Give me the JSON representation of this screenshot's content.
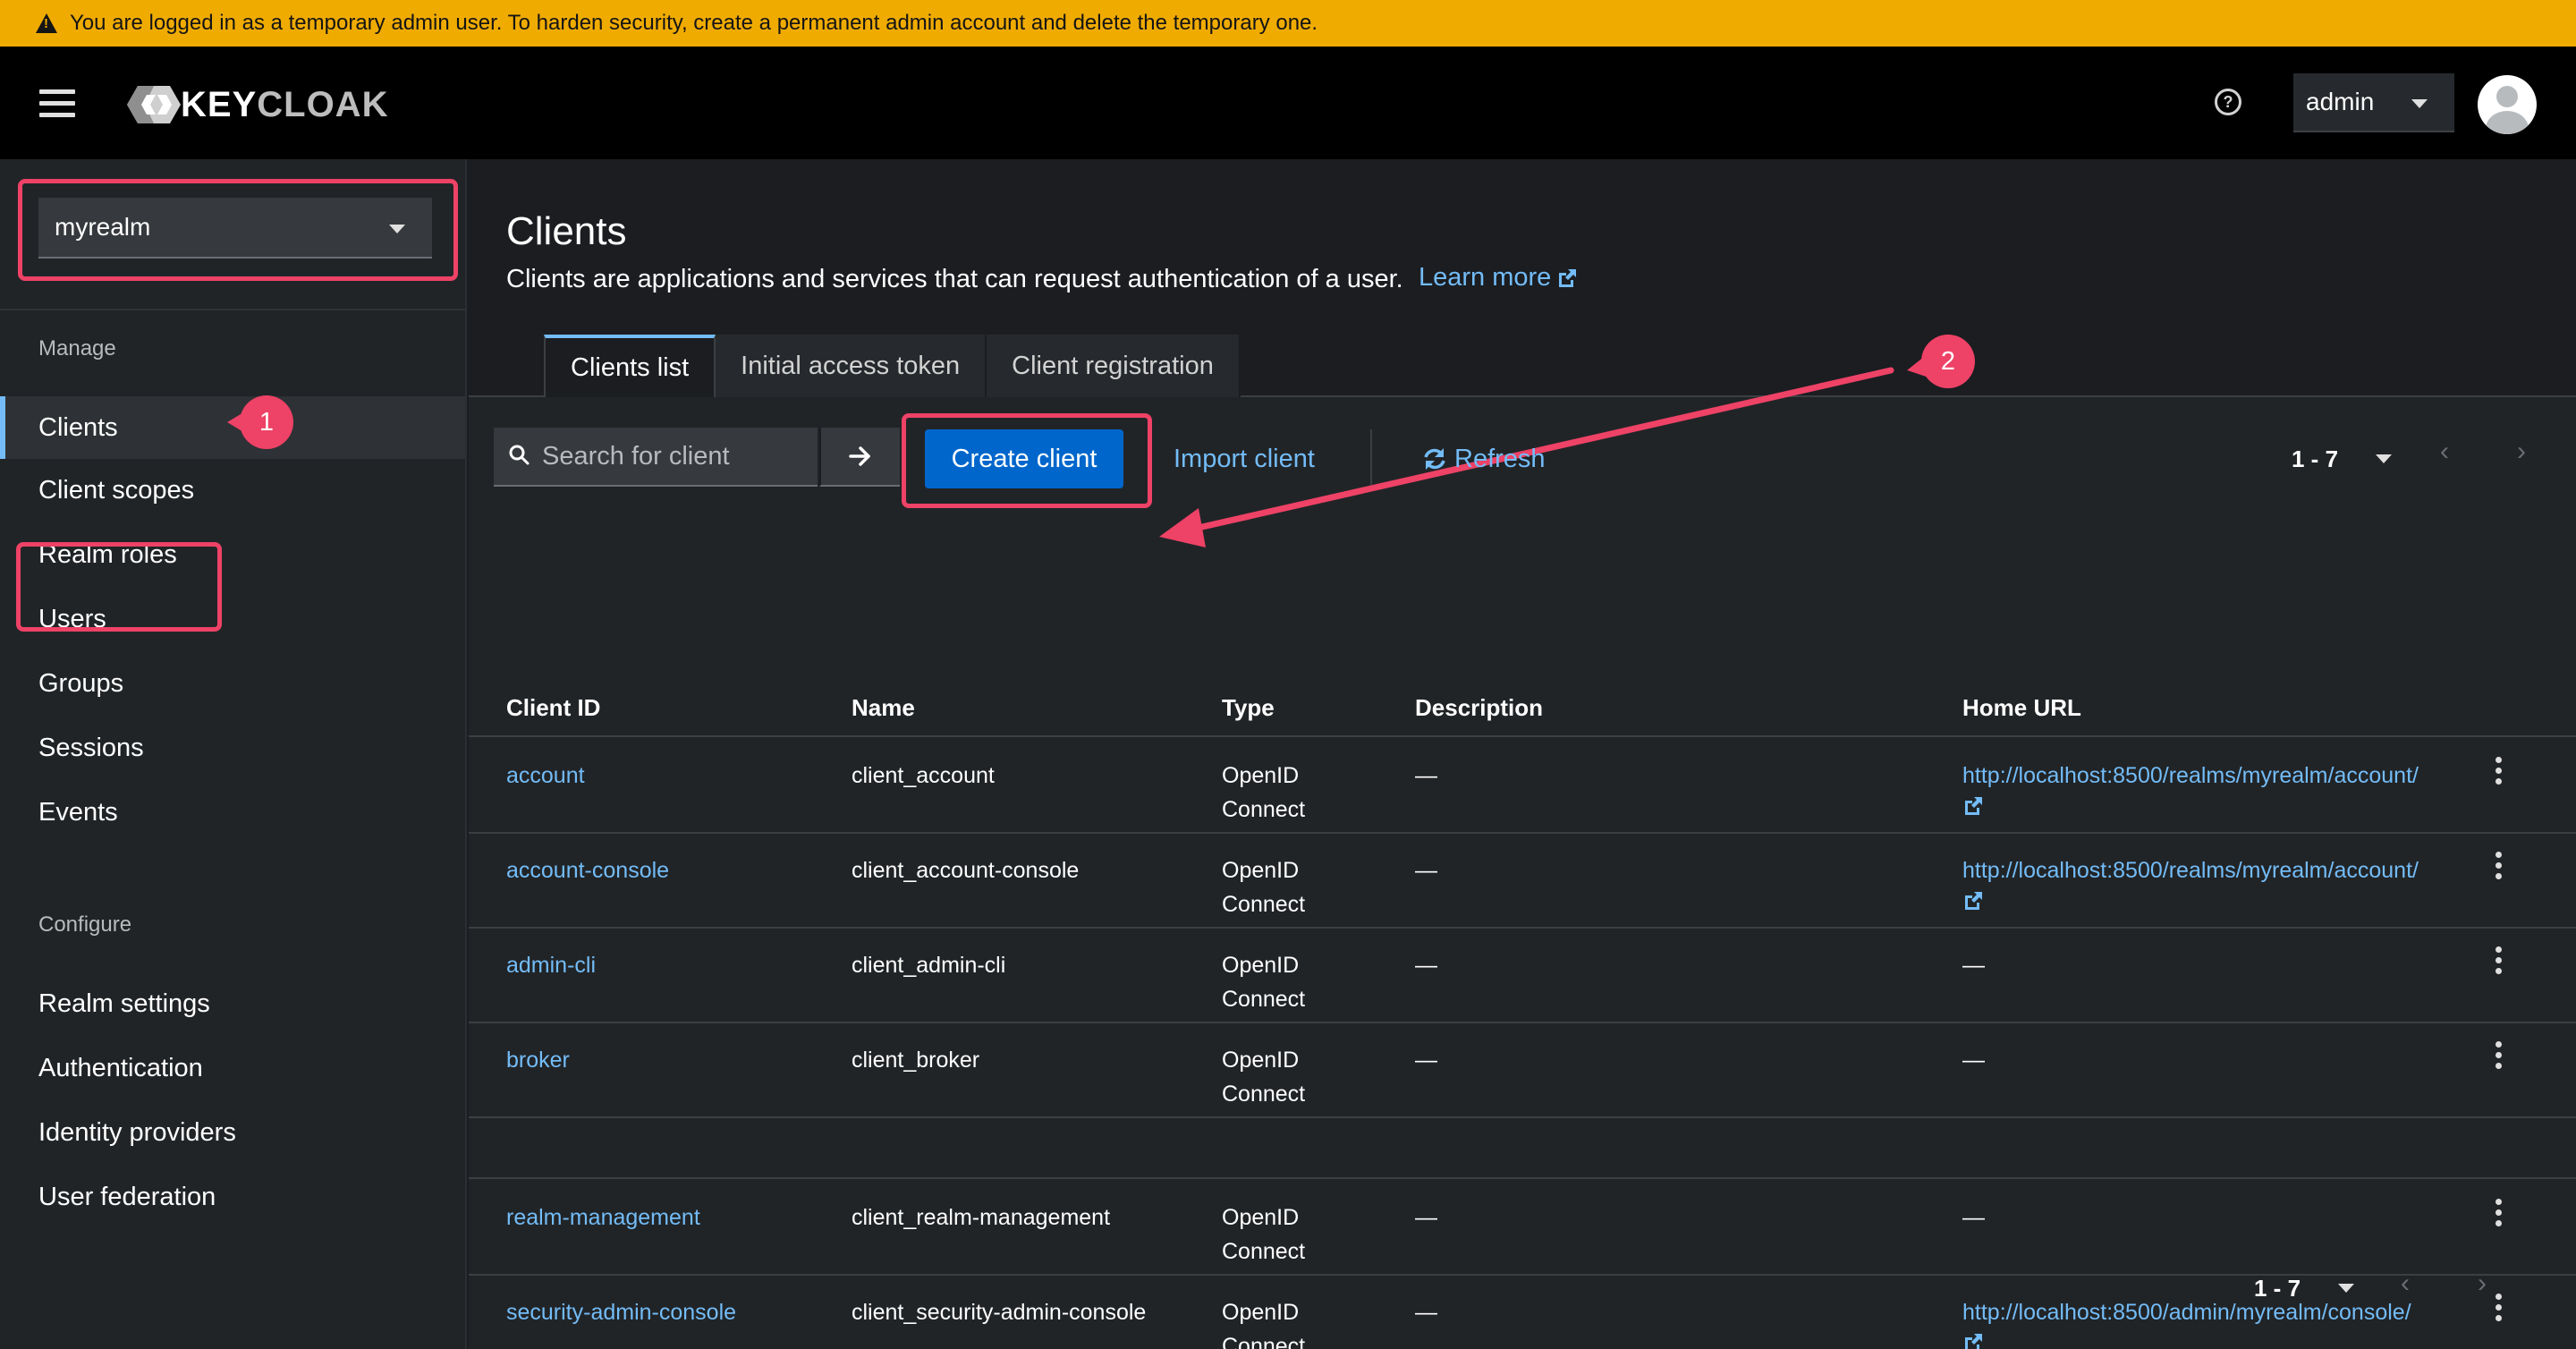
{
  "banner": {
    "text": "You are logged in as a temporary admin user. To harden security, create a permanent admin account and delete the temporary one."
  },
  "masthead": {
    "logo_key": "KEY",
    "logo_cloak": "CLOAK",
    "user": "admin",
    "help_glyph": "?"
  },
  "sidebar": {
    "realm": "myrealm",
    "manage_label": "Manage",
    "manage_items": [
      "Clients",
      "Client scopes",
      "Realm roles",
      "Users",
      "Groups",
      "Sessions",
      "Events"
    ],
    "configure_label": "Configure",
    "configure_items": [
      "Realm settings",
      "Authentication",
      "Identity providers",
      "User federation"
    ]
  },
  "annotations": {
    "badge1": "1",
    "badge2": "2"
  },
  "page": {
    "title": "Clients",
    "description": "Clients are applications and services that can request authentication of a user.",
    "learn_more": "Learn more",
    "tabs": [
      "Clients list",
      "Initial access token",
      "Client registration"
    ]
  },
  "toolbar": {
    "search_placeholder": "Search for client",
    "create_label": "Create client",
    "import_label": "Import client",
    "refresh_label": "Refresh",
    "pagination": "1 - 7"
  },
  "table": {
    "headers": [
      "Client ID",
      "Name",
      "Type",
      "Description",
      "Home URL"
    ],
    "rows": [
      {
        "id": "account",
        "name": "client_account",
        "type1": "OpenID",
        "type2": "Connect",
        "description": "—",
        "url": "http://localhost:8500/realms/myrealm/account/"
      },
      {
        "id": "account-console",
        "name": "client_account-console",
        "type1": "OpenID",
        "type2": "Connect",
        "description": "—",
        "url": "http://localhost:8500/realms/myrealm/account/"
      },
      {
        "id": "admin-cli",
        "name": "client_admin-cli",
        "type1": "OpenID",
        "type2": "Connect",
        "description": "—",
        "url": "—"
      },
      {
        "id": "broker",
        "name": "client_broker",
        "type1": "OpenID",
        "type2": "Connect",
        "description": "—",
        "url": "—"
      },
      {
        "id": "realm-management",
        "name": "client_realm-management",
        "type1": "OpenID",
        "type2": "Connect",
        "description": "—",
        "url": "—"
      },
      {
        "id": "security-admin-console",
        "name": "client_security-admin-console",
        "type1": "OpenID",
        "type2": "Connect",
        "description": "—",
        "url": "http://localhost:8500/admin/myrealm/console/"
      }
    ]
  },
  "colors": {
    "accent": "#73bcf7",
    "primary": "#0066cc",
    "highlight": "#ee4266",
    "banner": "#f0ab00"
  }
}
